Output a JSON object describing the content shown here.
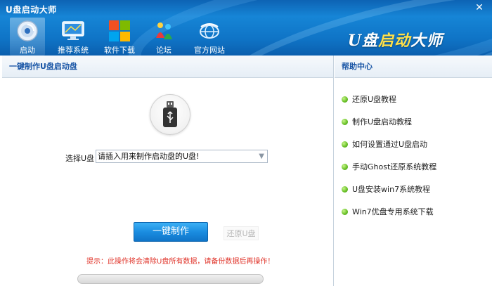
{
  "window": {
    "title": "U盘启动大师",
    "close_symbol": "✕"
  },
  "toolbar": {
    "items": [
      {
        "label": "启动",
        "icon": "boot-disc-icon",
        "active": true
      },
      {
        "label": "推荐系统",
        "icon": "monitor-icon",
        "active": false
      },
      {
        "label": "软件下载",
        "icon": "windows-logo-icon",
        "active": false
      },
      {
        "label": "论坛",
        "icon": "forum-people-icon",
        "active": false
      },
      {
        "label": "官方网站",
        "icon": "globe-icon",
        "active": false
      }
    ]
  },
  "brand": {
    "part1": "U盘",
    "part2": "启动",
    "part3": "大师"
  },
  "left_panel": {
    "header": "一键制作U盘启动盘",
    "select_label": "选择U盘",
    "select_value": "请插入用来制作启动盘的U盘!",
    "make_button": "一键制作",
    "restore_button": "还原U盘",
    "warning": "提示：此操作将会清除U盘所有数据，请备份数据后再操作！"
  },
  "help_panel": {
    "header": "帮助中心",
    "items": [
      "还原U盘教程",
      "制作U盘启动教程",
      "如何设置通过U盘启动",
      "手动Ghost还原系统教程",
      "U盘安装win7系统教程",
      "Win7优盘专用系统下载"
    ]
  },
  "colors": {
    "header_blue": "#1685d6",
    "accent_text": "#1a56a6",
    "warning_red": "#e0352b",
    "bullet_green": "#6cc32b"
  }
}
